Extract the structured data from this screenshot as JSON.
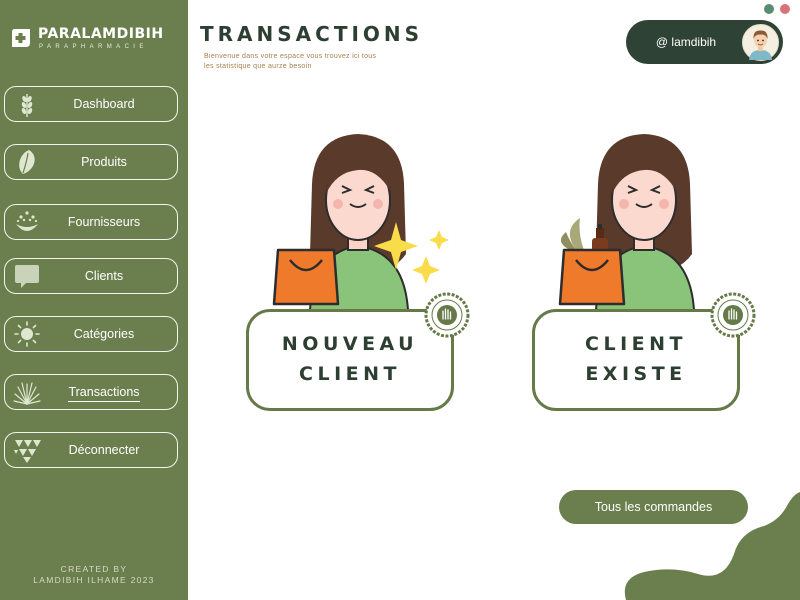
{
  "brand": {
    "name": "PARALAMDIBIH",
    "tagline": "PARAPHARMACIE",
    "icon": "medical-cross-icon"
  },
  "sidebar": {
    "items": [
      {
        "label": "Dashboard",
        "icon": "wheat-icon"
      },
      {
        "label": "Produits",
        "icon": "leaf-icon"
      },
      {
        "label": "Fournisseurs",
        "icon": "drops-icon"
      },
      {
        "label": "Clients",
        "icon": "chat-bubble-icon"
      },
      {
        "label": "Catégories",
        "icon": "sun-icon"
      },
      {
        "label": "Transactions",
        "icon": "palm-leaf-icon",
        "active": true
      },
      {
        "label": "Déconnecter",
        "icon": "triangles-icon"
      }
    ],
    "credits": [
      "CREATED BY",
      "LAMDIBIH ILHAME 2023"
    ]
  },
  "header": {
    "title": "TRANSACTIONS",
    "subtitle": "Bienvenue dans votre espace vous trouvez ici tous les statistique que aurze besoin"
  },
  "user": {
    "handle": "@ lamdibih",
    "avatar_icon": "man-avatar-icon"
  },
  "window_dots": [
    {
      "color": "#5b8c72"
    },
    {
      "color": "#d9737a"
    }
  ],
  "cards": [
    {
      "lines": [
        "NOUVEAU",
        "CLIENT"
      ],
      "illustration": "woman-shopping-bag-sparkles"
    },
    {
      "lines": [
        "CLIENT",
        "EXISTE"
      ],
      "illustration": "woman-shopping-bag-products"
    }
  ],
  "orders_button": {
    "label": "Tous les commandes"
  },
  "colors": {
    "sidebar": "#6b7f4e",
    "dark": "#2f4236",
    "accent_orange": "#f07a2c",
    "subtitle": "#a8804e"
  }
}
